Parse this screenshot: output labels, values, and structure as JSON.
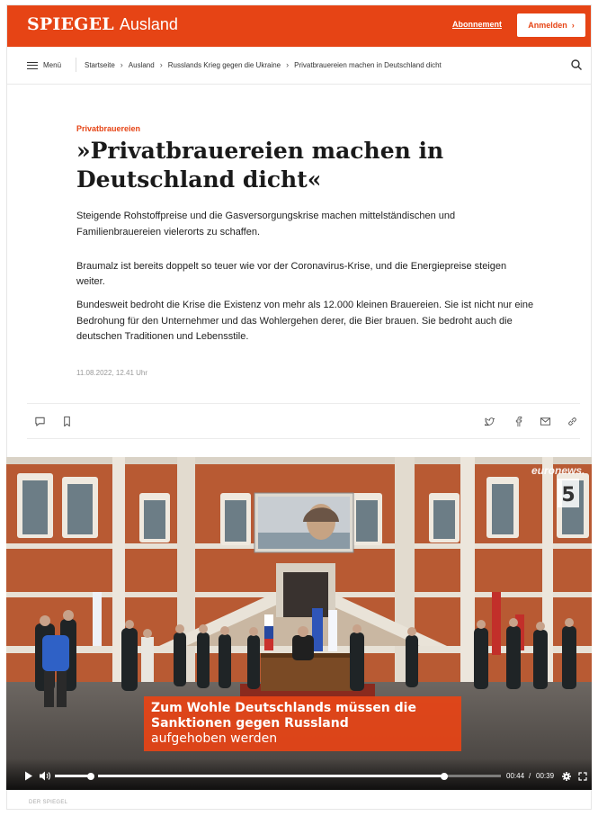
{
  "header": {
    "brand": "SPIEGEL",
    "section": "Ausland",
    "subscription_label": "Abonnement",
    "login_label": "Anmelden",
    "login_chevron": "›",
    "brand_color": "#e64415"
  },
  "nav": {
    "menu_label": "Menü",
    "breadcrumbs": [
      "Startseite",
      "Ausland",
      "Russlands Krieg gegen die Ukraine",
      "Privatbrauereien machen in Deutschland dicht"
    ],
    "search_icon": "search-icon"
  },
  "article": {
    "kicker": "Privatbrauereien",
    "headline": "»Privatbrauereien machen in Deutschland dicht«",
    "lead": "Steigende Rohstoffpreise und die Gasversorgungskrise machen mittelständischen und Familienbrauereien vielerorts zu schaffen.",
    "paragraphs": [
      "Braumalz ist bereits doppelt so teuer wie vor der Coronavirus-Krise, und die Energiepreise steigen weiter.",
      "Bundesweit bedroht die Krise die Existenz von mehr als 12.000 kleinen Brauereien. Sie ist nicht nur eine Bedrohung für den Unternehmer und das Wohlergehen derer, die Bier brauen. Sie bedroht auch die deutschen Traditionen und Lebensstile."
    ],
    "date": "11.08.2022, 12.41 Uhr"
  },
  "social": {
    "left_icons": [
      "comment-icon",
      "bookmark-icon"
    ],
    "right_icons": [
      "twitter-icon",
      "facebook-icon",
      "email-icon",
      "link-icon"
    ]
  },
  "video": {
    "watermark": "euronews.",
    "caption_lines": [
      "Zum Wohle Deutschlands müssen die",
      "Sanktionen gegen Russland",
      "aufgehoben werden"
    ],
    "time_current": "00:44",
    "time_separator": "/",
    "time_total": "00:39",
    "progress": 0.86,
    "volume": 0.8
  },
  "footer": {
    "credit": "DER SPIEGEL"
  }
}
